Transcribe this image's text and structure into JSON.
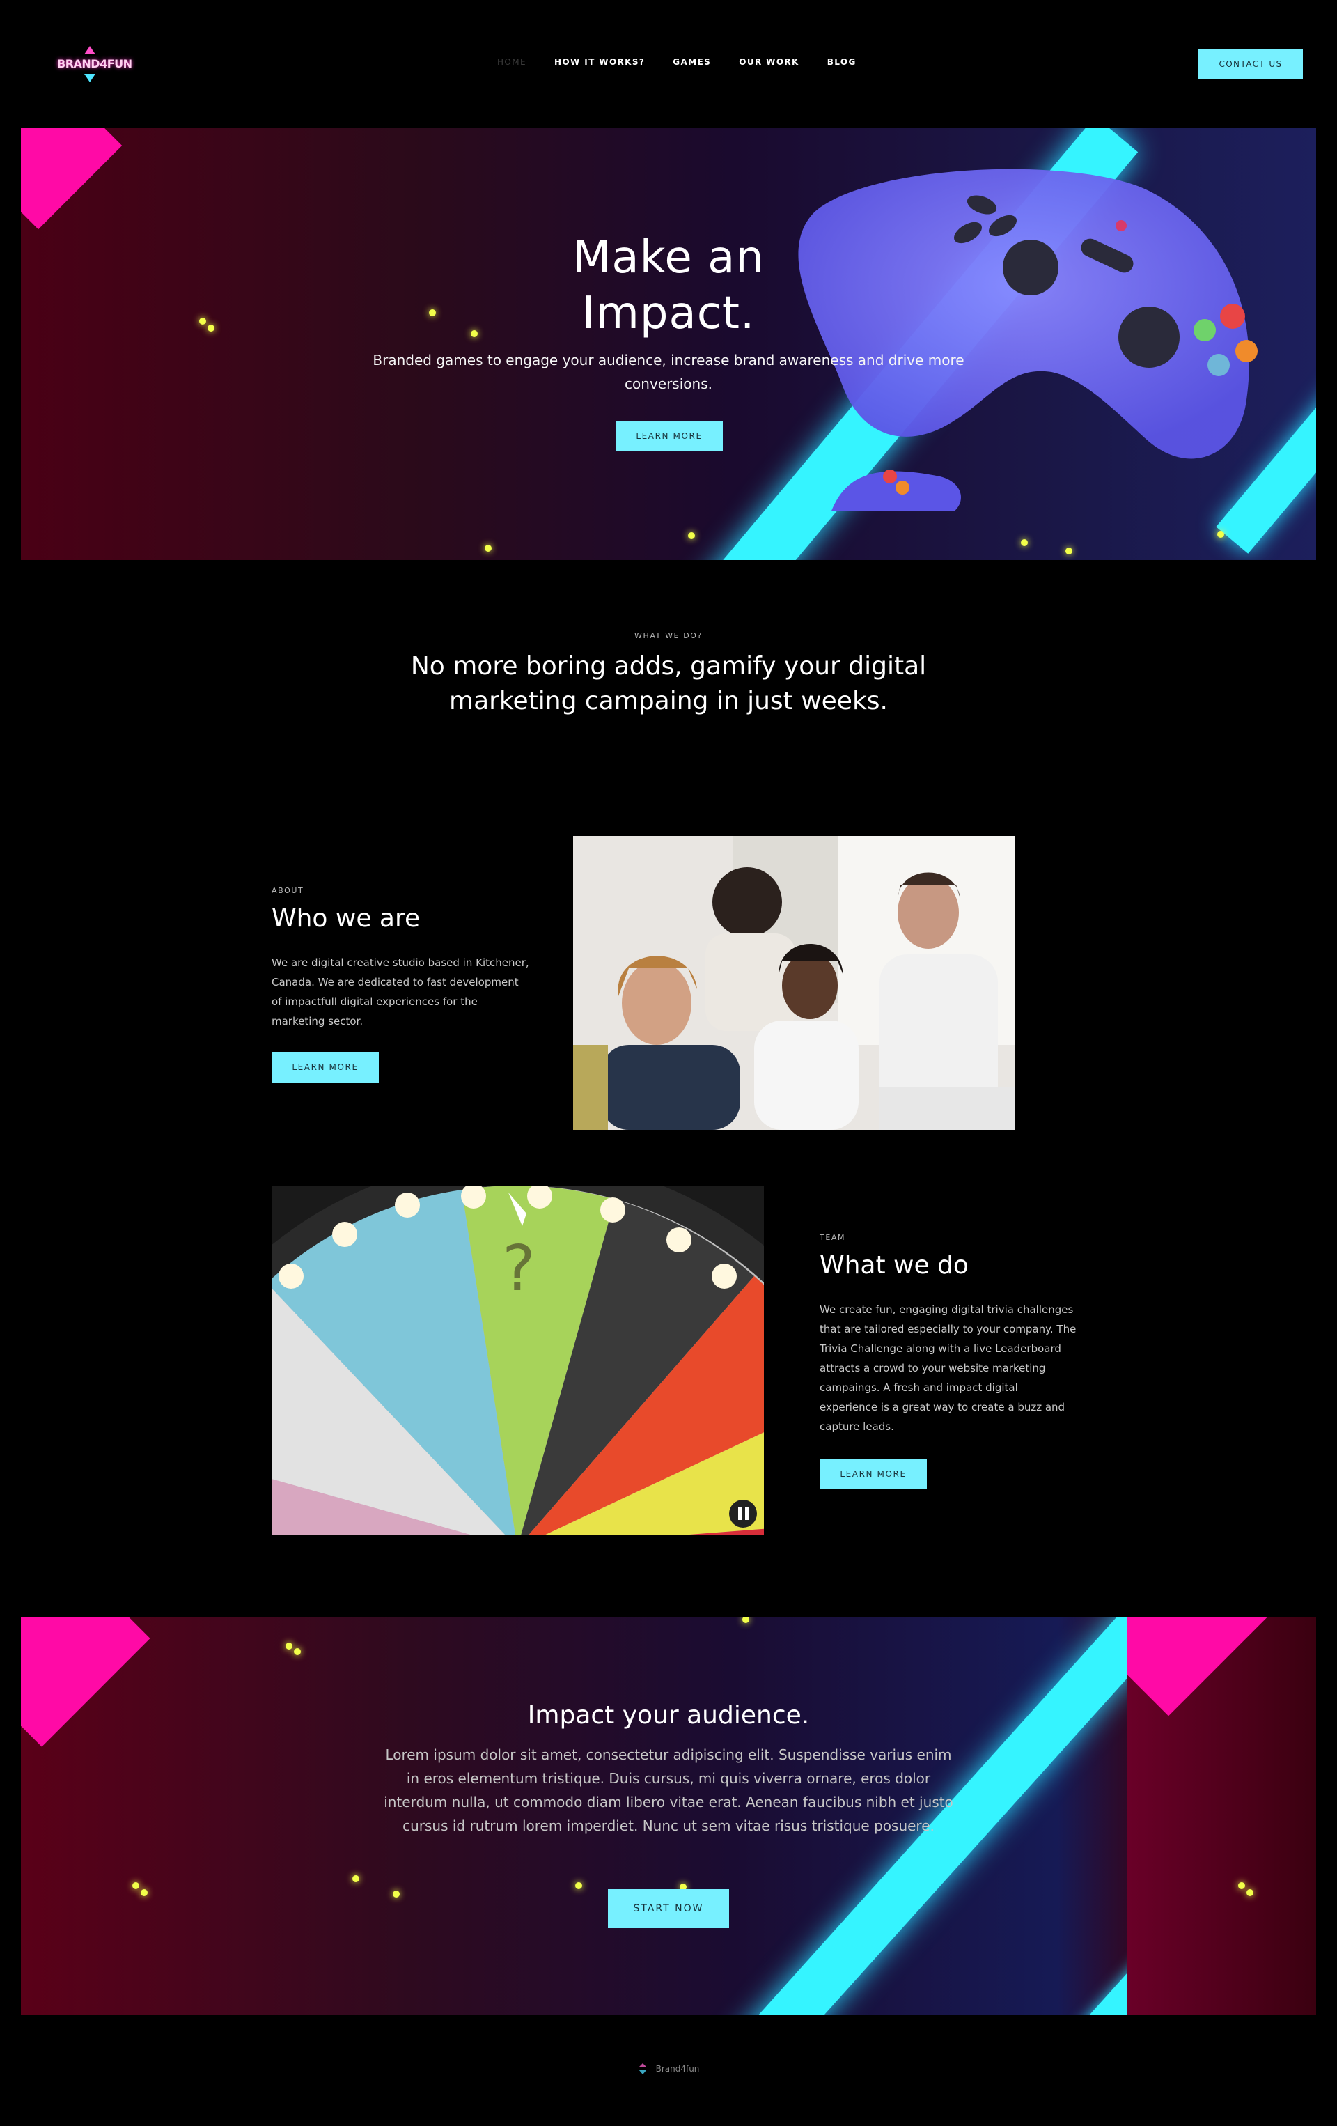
{
  "nav": {
    "logo_text": "BRAND4FUN",
    "links": [
      "HOME",
      "HOW IT WORKS?",
      "GAMES",
      "OUR WORK",
      "BLOG"
    ],
    "contact_label": "CONTACT US"
  },
  "hero": {
    "title_line1": "Make an",
    "title_line2": "Impact.",
    "subtitle": "Branded games to engage your audience, increase brand awareness and drive more conversions.",
    "button_label": "LEARN MORE"
  },
  "what_we_do": {
    "eyebrow": "WHAT WE DO?",
    "title": "No more boring adds, gamify your digital marketing campaing in just weeks."
  },
  "about": {
    "eyebrow": "ABOUT",
    "title": "Who we are",
    "text": "We are digital creative studio based in Kitchener, Canada. We are dedicated to fast development of impactfull digital experiences for the marketing sector.",
    "button_label": "LEARN MORE"
  },
  "team": {
    "eyebrow": "TEAM",
    "title": "What we do",
    "text": "We create fun, engaging digital trivia challenges that are tailored especially to your company. The Trivia Challenge along with a live Leaderboard attracts a crowd to your website marketing campaings. A fresh and impact digital experience is a great way to create a buzz and capture leads.",
    "button_label": "LEARN MORE"
  },
  "cta": {
    "title": "Impact your audience.",
    "text": "Lorem ipsum dolor sit amet, consectetur adipiscing elit. Suspendisse varius enim in eros elementum tristique. Duis cursus, mi quis viverra ornare, eros dolor interdum nulla, ut commodo diam libero vitae erat. Aenean faucibus nibh et justo cursus id rutrum lorem imperdiet. Nunc ut sem vitae risus tristique posuere.",
    "button_label": "START NOW"
  },
  "footer": {
    "text": "Brand4fun"
  },
  "colors": {
    "accent": "#77f0ff",
    "neon_cyan": "#35f4ff",
    "neon_pink": "#ff0aa6",
    "background": "#000000"
  },
  "icons": [
    "brand-logo-icon",
    "gamepad-illustration",
    "pause-icon",
    "footer-logo-icon"
  ]
}
